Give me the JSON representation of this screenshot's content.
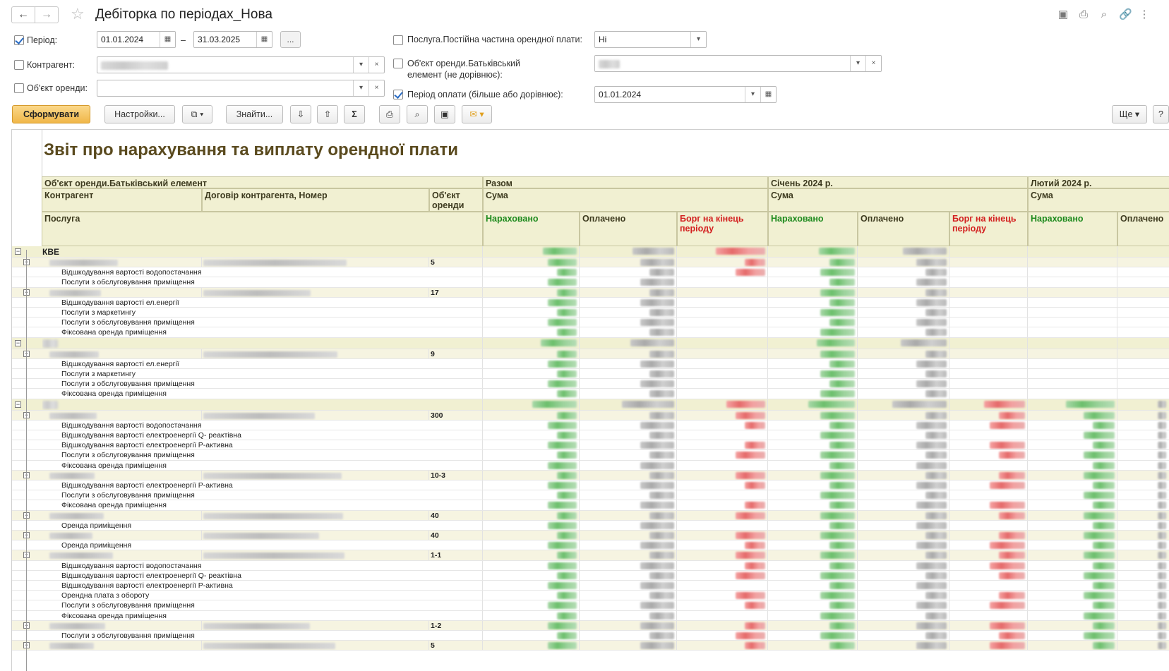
{
  "window": {
    "title": "Дебіторка по періодах_Нова"
  },
  "filters": {
    "period": {
      "label": "Період:",
      "checked": true,
      "from": "01.01.2024",
      "to": "31.03.2025",
      "dash": "–",
      "more": "..."
    },
    "counterparty": {
      "label": "Контрагент:",
      "checked": false
    },
    "rent_object": {
      "label": "Об'єкт оренди:",
      "checked": false
    },
    "service_fixed": {
      "label": "Послуга.Постійна частина орендної плати:",
      "checked": false,
      "value": "Ні"
    },
    "parent_element": {
      "label_line1": "Об'єкт оренди.Батьківський",
      "label_line2": "елемент (не дорівнює):",
      "checked": false
    },
    "payment_period": {
      "label": "Період оплати (більше або дорівнює):",
      "checked": true,
      "value": "01.01.2024"
    }
  },
  "toolbar": {
    "generate": "Сформувати",
    "settings": "Настройки...",
    "find": "Знайти...",
    "sum": "Σ",
    "more": "Ще",
    "help": "?"
  },
  "report": {
    "title": "Звіт про нарахування та виплату орендної плати",
    "headers": {
      "parent": "Об'єкт оренди.Батьківський елемент",
      "counterparty": "Контрагент",
      "contract": "Договір контрагента, Номер",
      "object_line1": "Об'єкт",
      "object_line2": "оренди",
      "service": "Послуга",
      "total": "Разом",
      "jan": "Січень 2024 р.",
      "feb": "Лютий 2024 р.",
      "sum": "Сума",
      "accrued": "Нараховано",
      "paid": "Оплачено",
      "debt_line1": "Борг на кінець",
      "debt_line2": "періоду"
    },
    "rows": [
      {
        "type": "top",
        "name": "КВЕ"
      },
      {
        "type": "grp",
        "object": "5"
      },
      {
        "type": "svc",
        "name": "Відшкодування вартості водопостачання"
      },
      {
        "type": "svc",
        "name": "Послуги з обслуговування приміщення"
      },
      {
        "type": "grp",
        "object": "17"
      },
      {
        "type": "svc",
        "name": "Відшкодування вартості ел.енергії"
      },
      {
        "type": "svc",
        "name": "Послуги з маркетингу"
      },
      {
        "type": "svc",
        "name": "Послуги з обслуговування приміщення"
      },
      {
        "type": "svc",
        "name": "Фіксована оренда приміщення"
      },
      {
        "type": "top",
        "name": ""
      },
      {
        "type": "grp",
        "object": "9"
      },
      {
        "type": "svc",
        "name": "Відшкодування вартості ел.енергії"
      },
      {
        "type": "svc",
        "name": "Послуги з маркетингу"
      },
      {
        "type": "svc",
        "name": "Послуги з обслуговування приміщення"
      },
      {
        "type": "svc",
        "name": "Фіксована оренда приміщення"
      },
      {
        "type": "top",
        "name": ""
      },
      {
        "type": "grp",
        "object": "300"
      },
      {
        "type": "svc",
        "name": "Відшкодування вартості водопостачання"
      },
      {
        "type": "svc",
        "name": "Відшкодування вартості електроенергії  Q- реактівна"
      },
      {
        "type": "svc",
        "name": "Відшкодування вартості електроенергії Р-активна"
      },
      {
        "type": "svc",
        "name": "Послуги з обслуговування приміщення"
      },
      {
        "type": "svc",
        "name": "Фіксована оренда приміщення"
      },
      {
        "type": "grp",
        "object": "10-3"
      },
      {
        "type": "svc",
        "name": "Відшкодування вартості електроенергії Р-активна"
      },
      {
        "type": "svc",
        "name": "Послуги з обслуговування приміщення"
      },
      {
        "type": "svc",
        "name": "Фіксована оренда приміщення"
      },
      {
        "type": "grp",
        "object": "40"
      },
      {
        "type": "svc",
        "name": "Оренда приміщення"
      },
      {
        "type": "grp",
        "object": "40"
      },
      {
        "type": "svc",
        "name": "Оренда приміщення"
      },
      {
        "type": "grp",
        "object": "1-1"
      },
      {
        "type": "svc",
        "name": "Відшкодування вартості водопостачання"
      },
      {
        "type": "svc",
        "name": "Відшкодування вартості електроенергії  Q- реактівна"
      },
      {
        "type": "svc",
        "name": "Відшкодування вартості електроенергії Р-активна"
      },
      {
        "type": "svc",
        "name": "Орендна плата з обороту"
      },
      {
        "type": "svc",
        "name": "Послуги з обслуговування приміщення"
      },
      {
        "type": "svc",
        "name": "Фіксована оренда приміщення"
      },
      {
        "type": "grp",
        "object": "1-2"
      },
      {
        "type": "svc",
        "name": "Послуги з обслуговування приміщення"
      },
      {
        "type": "grp",
        "object": "5"
      }
    ]
  }
}
